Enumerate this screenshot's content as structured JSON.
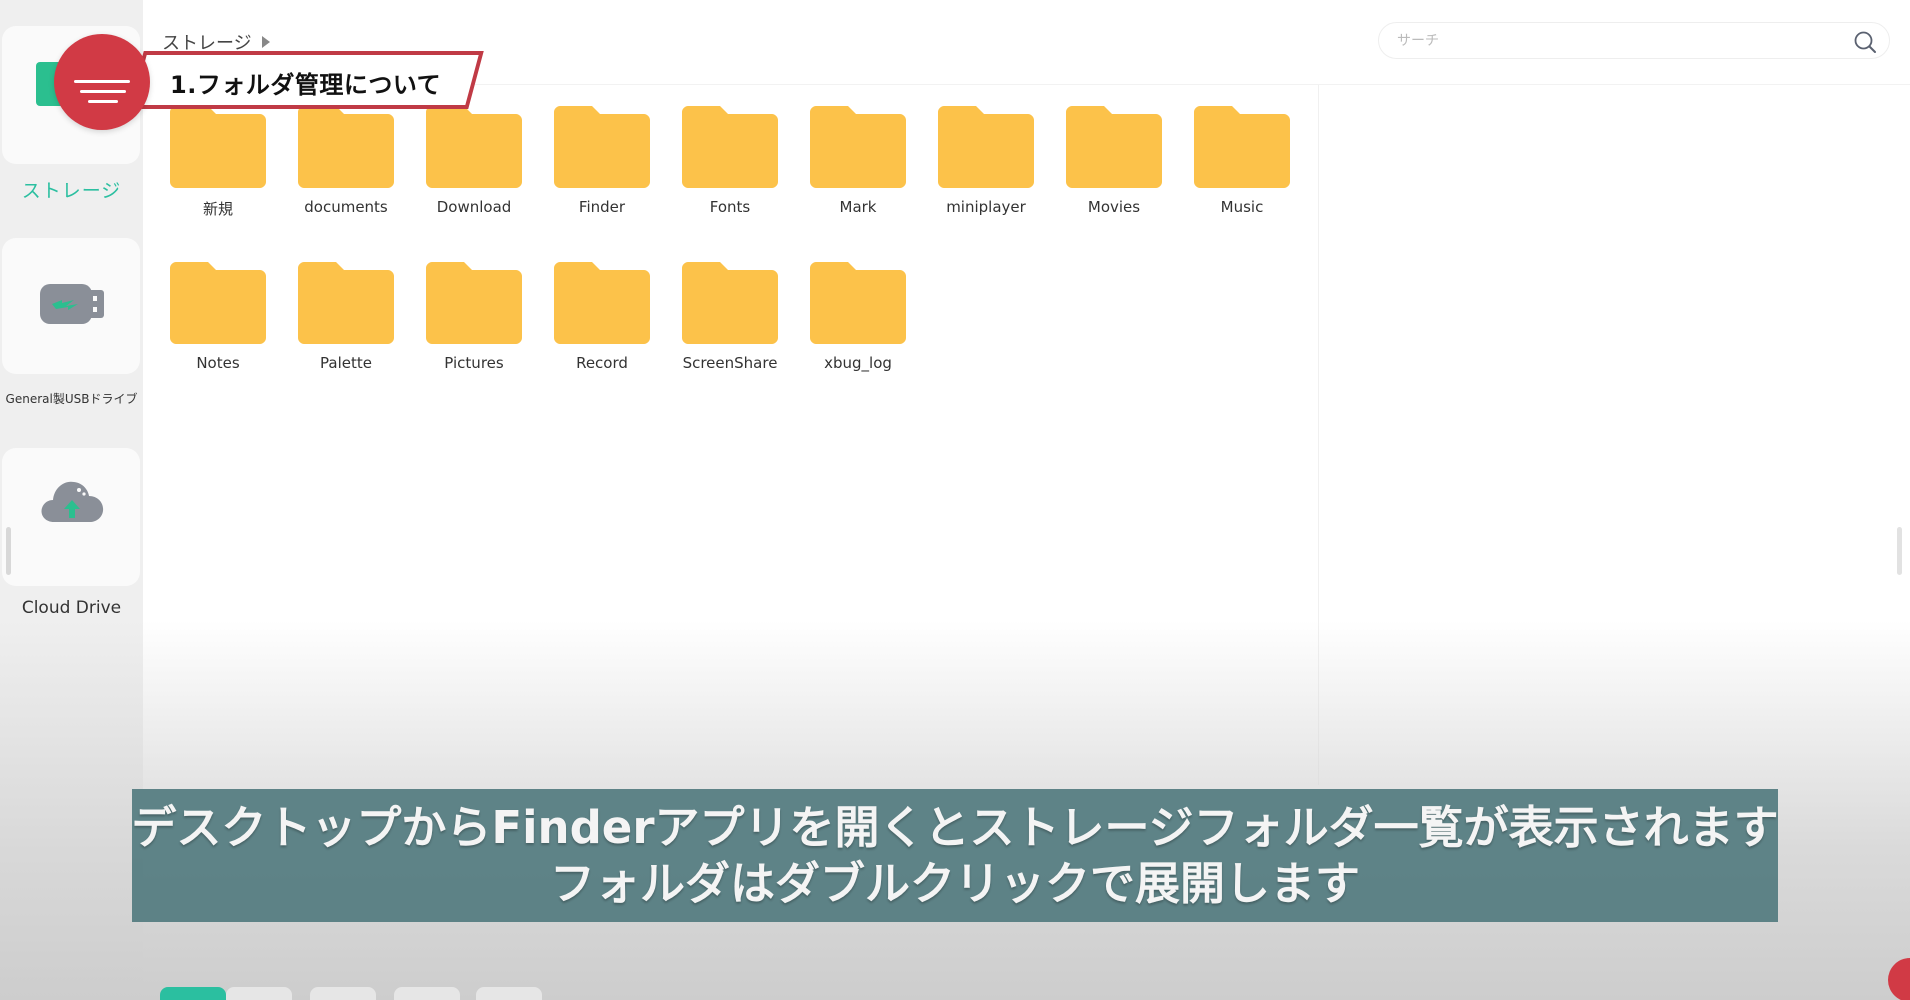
{
  "breadcrumb": {
    "current": "ストレージ"
  },
  "search": {
    "placeholder": "サーチ"
  },
  "sidebar": {
    "items": [
      {
        "label": "ストレージ",
        "icon": "storage-icon",
        "active": true
      },
      {
        "label": "General製USBドライブ",
        "icon": "usb-drive-icon",
        "active": false
      },
      {
        "label": "Cloud Drive",
        "icon": "cloud-upload-icon",
        "active": false
      }
    ]
  },
  "banner": {
    "title": "1.フォルダ管理について"
  },
  "folders": [
    {
      "name": "新規"
    },
    {
      "name": "documents"
    },
    {
      "name": "Download"
    },
    {
      "name": "Finder"
    },
    {
      "name": "Fonts"
    },
    {
      "name": "Mark"
    },
    {
      "name": "miniplayer"
    },
    {
      "name": "Movies"
    },
    {
      "name": "Music"
    },
    {
      "name": "Notes"
    },
    {
      "name": "Palette"
    },
    {
      "name": "Pictures"
    },
    {
      "name": "Record"
    },
    {
      "name": "ScreenShare"
    },
    {
      "name": "xbug_log"
    }
  ],
  "subtitle": {
    "line1": "デスクトップからFinderアプリを開くとストレージフォルダ一覧が表示されます",
    "line2": "フォルダはダブルクリックで展開します"
  },
  "colors": {
    "accent": "#2bbfa0",
    "folder": "#fcc24a",
    "banner_red": "#d13a45",
    "subtitle_bg": "#547c80"
  }
}
